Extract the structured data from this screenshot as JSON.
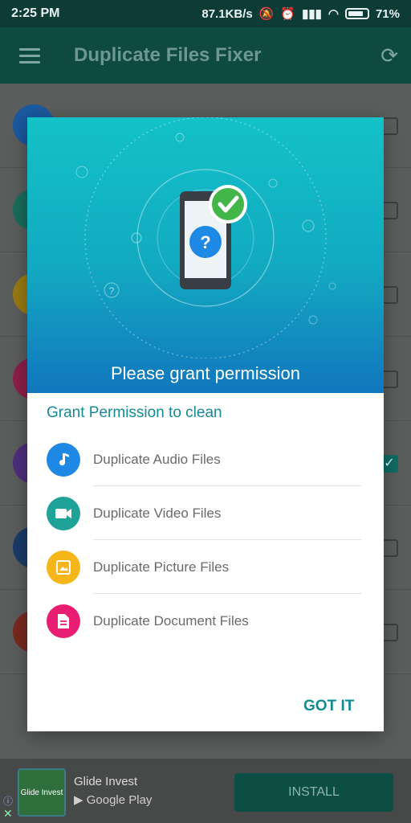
{
  "status_bar": {
    "time": "2:25 PM",
    "speed": "87.1KB/s",
    "battery": "71%"
  },
  "app_bar": {
    "title": "Duplicate Files Fixer"
  },
  "dialog": {
    "hero_title": "Please grant permission",
    "section_title": "Grant Permission to clean",
    "items": [
      {
        "label": "Duplicate Audio Files",
        "icon": "music-note-icon",
        "color": "#1e88e5"
      },
      {
        "label": "Duplicate Video Files",
        "icon": "video-camera-icon",
        "color": "#1fa398"
      },
      {
        "label": "Duplicate Picture Files",
        "icon": "image-icon",
        "color": "#f6b61a"
      },
      {
        "label": "Duplicate Document Files",
        "icon": "document-icon",
        "color": "#e91e72"
      }
    ],
    "confirm_label": "GOT IT"
  },
  "ad": {
    "logo_text": "Glide Invest",
    "name": "Glide Invest",
    "store": "Google Play",
    "install_label": "INSTALL"
  },
  "colors": {
    "accent": "#148a95",
    "app_bar": "#0f4a42"
  }
}
